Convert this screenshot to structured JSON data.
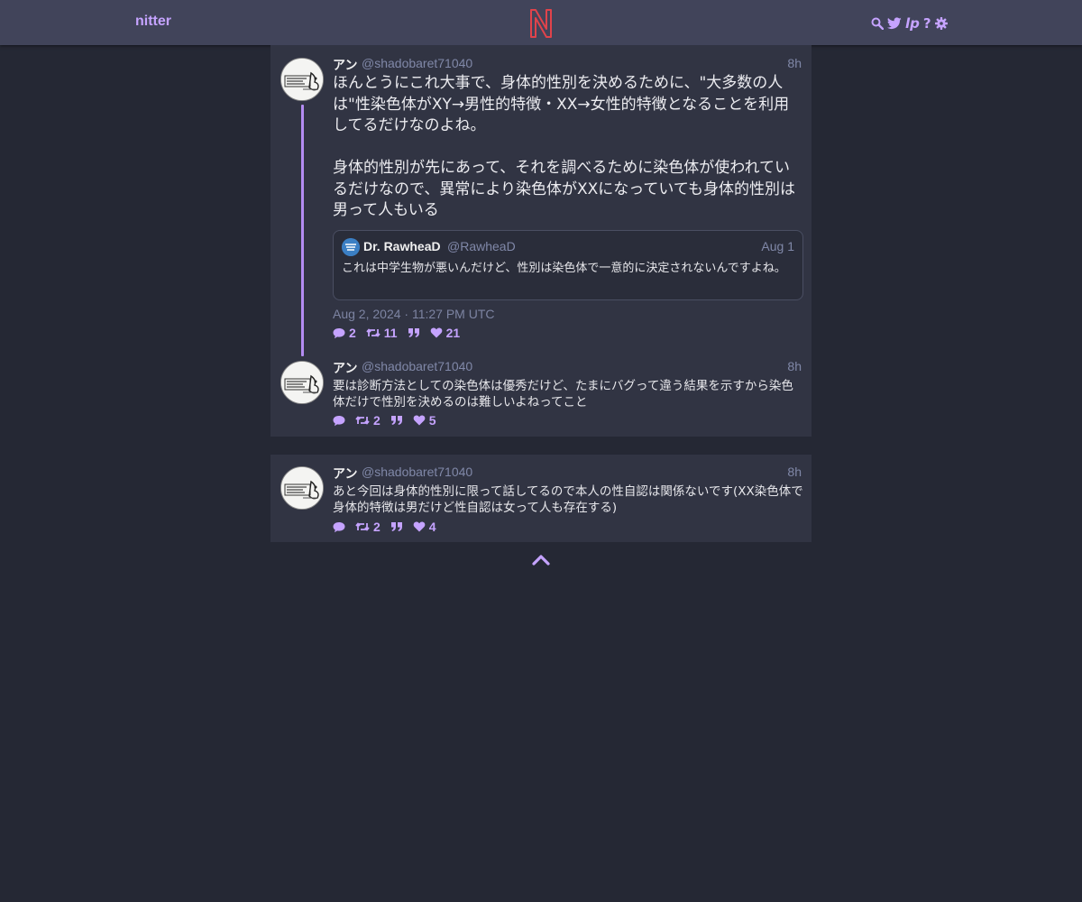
{
  "header": {
    "brand": "nitter",
    "icons": [
      "search-icon",
      "twitter-bird-icon",
      "lp-icon",
      "help-icon",
      "gear-icon"
    ],
    "lp_label": "lp",
    "help_label": "?"
  },
  "colors": {
    "accent": "#c5a3ff",
    "background": "#252834",
    "panel": "#313443",
    "navbar": "#41445a",
    "logo": "#e0434b"
  },
  "main_tweet": {
    "fullname": "アン",
    "username": "@shadobaret71040",
    "time": "8h",
    "text": "ほんとうにこれ大事で、身体的性別を決めるために、\"大多数の人は\"性染色体がXY→男性的特徴・XX→女性的特徴となることを利用してるだけなのよね。\n\n身体的性別が先にあって、それを調べるために染色体が使われているだけなので、異常により染色体がXXになっていても身体的性別は男って人もいる",
    "quote": {
      "fullname": "Dr. RawheaD",
      "username": "@RawheaD",
      "time": "Aug 1",
      "text": "これは中学生物が悪いんだけど、性別は染色体で一意的に決定されないんですよね。"
    },
    "published": "Aug 2, 2024 · 11:27 PM UTC",
    "stats": {
      "replies": "2",
      "retweets": "11",
      "quotes": "",
      "likes": "21"
    }
  },
  "reply_1": {
    "fullname": "アン",
    "username": "@shadobaret71040",
    "time": "8h",
    "text": "要は診断方法としての染色体は優秀だけど、たまにバグって違う結果を示すから染色体だけで性別を決めるのは難しいよねってこと",
    "stats": {
      "replies": "",
      "retweets": "2",
      "quotes": "",
      "likes": "5"
    }
  },
  "reply_2": {
    "fullname": "アン",
    "username": "@shadobaret71040",
    "time": "8h",
    "text": "あと今回は身体的性別に限って話してるので本人の性自認は関係ないです(XX染色体で身体的特徴は男だけど性自認は女って人も存在する)",
    "stats": {
      "replies": "",
      "retweets": "2",
      "quotes": "",
      "likes": "4"
    }
  },
  "footer": {
    "icon": "chevron-up-icon"
  }
}
